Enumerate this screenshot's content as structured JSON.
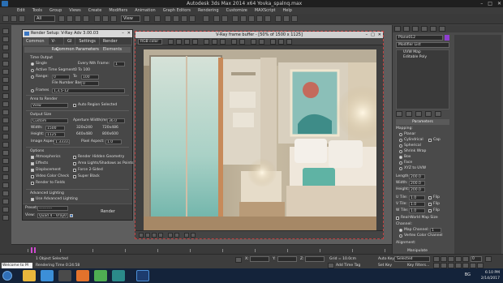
{
  "app": {
    "title": "Autodesk 3ds Max  2014 x64     Yovka_spalnq.max",
    "window_buttons": [
      "–",
      "□",
      "✕"
    ]
  },
  "menu": [
    "Edit",
    "Tools",
    "Group",
    "Views",
    "Create",
    "Modifiers",
    "Animation",
    "Graph Editors",
    "Rendering",
    "Customize",
    "MAXScript",
    "Help"
  ],
  "toolbar": {
    "selection_filter": "All",
    "reference_coord": "View"
  },
  "render_setup": {
    "title": "Render Setup: V-Ray Adv 3.00.03",
    "tabs": [
      "Common",
      "V-Ray",
      "GI",
      "Settings",
      "Render Elements"
    ],
    "active_tab": "Common",
    "section": "Common Parameters",
    "time_output_label": "Time Output",
    "single_label": "Single",
    "every_nth_label": "Every Nth Frame:",
    "every_nth_value": "1",
    "active_segment_label": "Active Time Segment:",
    "active_segment_value": "0 To 100",
    "range_label": "Range:",
    "range_from": "0",
    "range_to_label": "To",
    "range_to": "100",
    "file_number_base_label": "File Number Base:",
    "file_number_base_value": "0",
    "frames_label": "Frames",
    "frames_value": "1,3,5-12",
    "area_label": "Area to Render",
    "area_value": "View",
    "auto_region_label": "Auto Region Selected",
    "output_size_label": "Output Size",
    "output_size_value": "Custom",
    "aperture_label": "Aperture Width(mm):",
    "aperture_value": "36.0",
    "width_label": "Width:",
    "width_value": "1500",
    "height_label": "Height:",
    "height_value": "1125",
    "presets": [
      "320x240",
      "720x486",
      "640x480",
      "800x600"
    ],
    "image_aspect_label": "Image Aspect:",
    "image_aspect_value": "1.33333",
    "pixel_aspect_label": "Pixel Aspect:",
    "pixel_aspect_value": "1.0",
    "options_label": "Options",
    "options": [
      {
        "label": "Atmospherics",
        "checked": true
      },
      {
        "label": "Render Hidden Geometry",
        "checked": false
      },
      {
        "label": "Effects",
        "checked": true
      },
      {
        "label": "Area Lights/Shadows as Points",
        "checked": false
      },
      {
        "label": "Displacement",
        "checked": true
      },
      {
        "label": "Force 2-Sided",
        "checked": false
      },
      {
        "label": "Video Color Check",
        "checked": false
      },
      {
        "label": "Super Black",
        "checked": false
      },
      {
        "label": "Render to Fields",
        "checked": false
      }
    ],
    "advanced_lighting_label": "Advanced Lighting",
    "use_adv_lighting_label": "Use Advanced Lighting",
    "preset_label": "Preset:",
    "preset_value": "----------",
    "view_label": "View:",
    "view_value": "Quad 4 - Vray0",
    "render_button": "Render"
  },
  "frame_buffer": {
    "title": "V-Ray frame buffer - [50% of 1500 x 1125]",
    "channel": "RGB color",
    "window_buttons": [
      "–",
      "□",
      "✕"
    ]
  },
  "command_panel": {
    "object_name": "Plane012",
    "object_color": "#8e3fd0",
    "modifier_list": "Modifier List",
    "stack": [
      "UVW Map",
      "Editable Poly"
    ],
    "parameters_label": "Parameters",
    "mapping_label": "Mapping:",
    "mapping_options": [
      {
        "label": "Planar",
        "on": false
      },
      {
        "label": "Cylindrical",
        "on": false
      },
      {
        "label": "Spherical",
        "on": false
      },
      {
        "label": "Shrink Wrap",
        "on": false
      },
      {
        "label": "Box",
        "on": true
      },
      {
        "label": "Face",
        "on": false
      },
      {
        "label": "XYZ to UVW",
        "on": false
      }
    ],
    "cap_label": "Cap",
    "length_label": "Length:",
    "length_value": "200.0",
    "width_label": "Width:",
    "width_value": "200.0",
    "height_label": "Height:",
    "height_value": "200.0",
    "tile_rows": [
      {
        "label": "U Tile:",
        "value": "1.0",
        "flip": "Flip"
      },
      {
        "label": "V Tile:",
        "value": "1.0",
        "flip": "Flip"
      },
      {
        "label": "W Tile:",
        "value": "1.0",
        "flip": "Flip"
      }
    ],
    "real_world_label": "Real-World Map Size",
    "channel_label": "Channel:",
    "map_channel_label": "Map Channel:",
    "map_channel_value": "1",
    "vertex_color_label": "Vertex Color Channel",
    "alignment_label": "Alignment:",
    "manipulate_label": "Manipulate"
  },
  "timeline": {
    "position": "0 / 100"
  },
  "status": {
    "maxscript": "Welcome to M",
    "objects_selected": "1 Object Selected",
    "rendering_time": "Rendering Time  0:24:58",
    "x_label": "X:",
    "y_label": "Y:",
    "z_label": "Z:",
    "grid": "Grid = 10.0cm",
    "add_time_tag": "Add Time Tag",
    "auto_key": "Auto Key",
    "selected": "Selected",
    "set_key": "Set Key",
    "key_filters": "Key Filters...",
    "frame": "0"
  },
  "taskbar": {
    "lang": "BG",
    "time": "6:10 PM",
    "date": "2/14/2017",
    "apps": [
      "explorer",
      "media",
      "firefox",
      "chrome",
      "3dsmax",
      "photoshop"
    ]
  }
}
